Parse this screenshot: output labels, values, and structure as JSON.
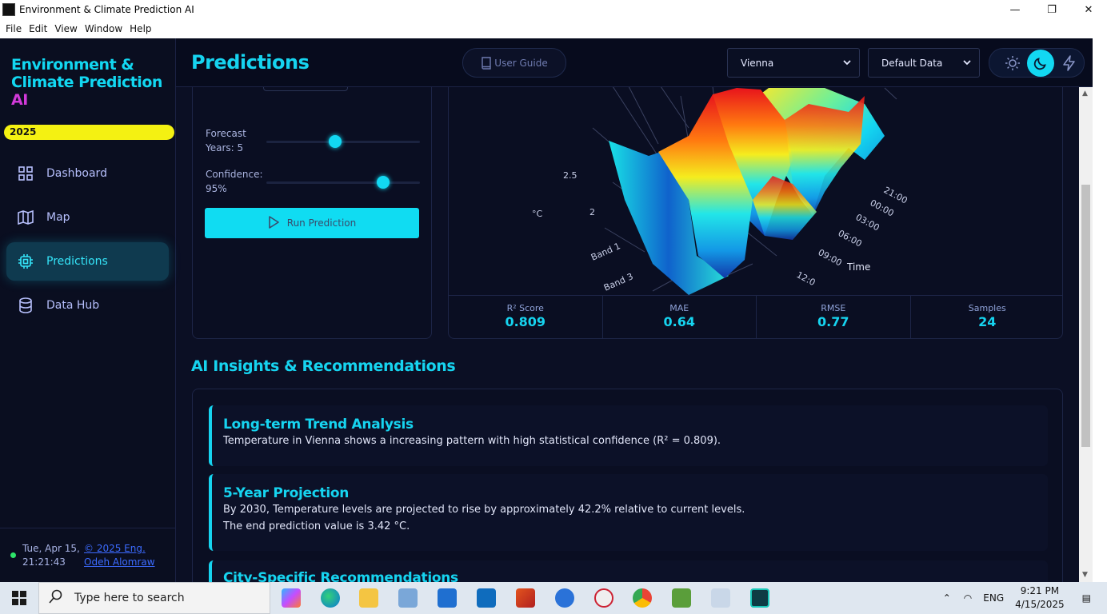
{
  "window": {
    "title": "Environment & Climate Prediction AI",
    "controls": [
      "—",
      "❐",
      "✕"
    ]
  },
  "menu": [
    "File",
    "Edit",
    "View",
    "Window",
    "Help"
  ],
  "sidebar": {
    "brand_line1": "Environment &",
    "brand_line2": "Climate Prediction",
    "brand_line3": "AI",
    "year": "2025",
    "items": [
      {
        "label": "Dashboard",
        "icon": "grid-icon"
      },
      {
        "label": "Map",
        "icon": "map-icon"
      },
      {
        "label": "Predictions",
        "icon": "chip-icon"
      },
      {
        "label": "Data Hub",
        "icon": "database-icon"
      }
    ],
    "date": "Tue, Apr 15,",
    "time": "21:21:43",
    "copyright_line1": "© 2025 Eng.",
    "copyright_line2": "Odeh Alomraw"
  },
  "header": {
    "title": "Predictions",
    "guide_label": "User Guide",
    "city": "Vienna",
    "dataset": "Default Data"
  },
  "controls": {
    "forecast_label_1": "Forecast",
    "forecast_label_2": "Years: 5",
    "forecast_value": 5,
    "confidence_label_1": "Confidence:",
    "confidence_label_2": "95%",
    "confidence_value": 0.95,
    "run_label": "Run Prediction"
  },
  "chart": {
    "z_ticks": [
      "2.5",
      "2"
    ],
    "z_unit": "°C",
    "band_labels": [
      "Band 1",
      "Band 3"
    ],
    "time_ticks": [
      "21:00",
      "00:00",
      "03:00",
      "06:00",
      "09:00",
      "12:0"
    ],
    "time_label": "Time"
  },
  "metrics": [
    {
      "label": "R² Score",
      "value": "0.809"
    },
    {
      "label": "MAE",
      "value": "0.64"
    },
    {
      "label": "RMSE",
      "value": "0.77"
    },
    {
      "label": "Samples",
      "value": "24"
    }
  ],
  "insights": {
    "title": "AI Insights & Recommendations",
    "cards": [
      {
        "title": "Long-term Trend Analysis",
        "text": "Temperature in Vienna shows a increasing pattern with high statistical confidence (R² = 0.809)."
      },
      {
        "title": "5-Year Projection",
        "text": "By 2030, Temperature levels are projected to rise by approximately 42.2% relative to current levels.",
        "text2": "The end prediction value is 3.42 °C."
      },
      {
        "title": "City-Specific Recommendations"
      }
    ]
  },
  "taskbar": {
    "search_placeholder": "Type here to search",
    "lang": "ENG",
    "time": "9:21 PM",
    "date": "4/15/2025"
  }
}
